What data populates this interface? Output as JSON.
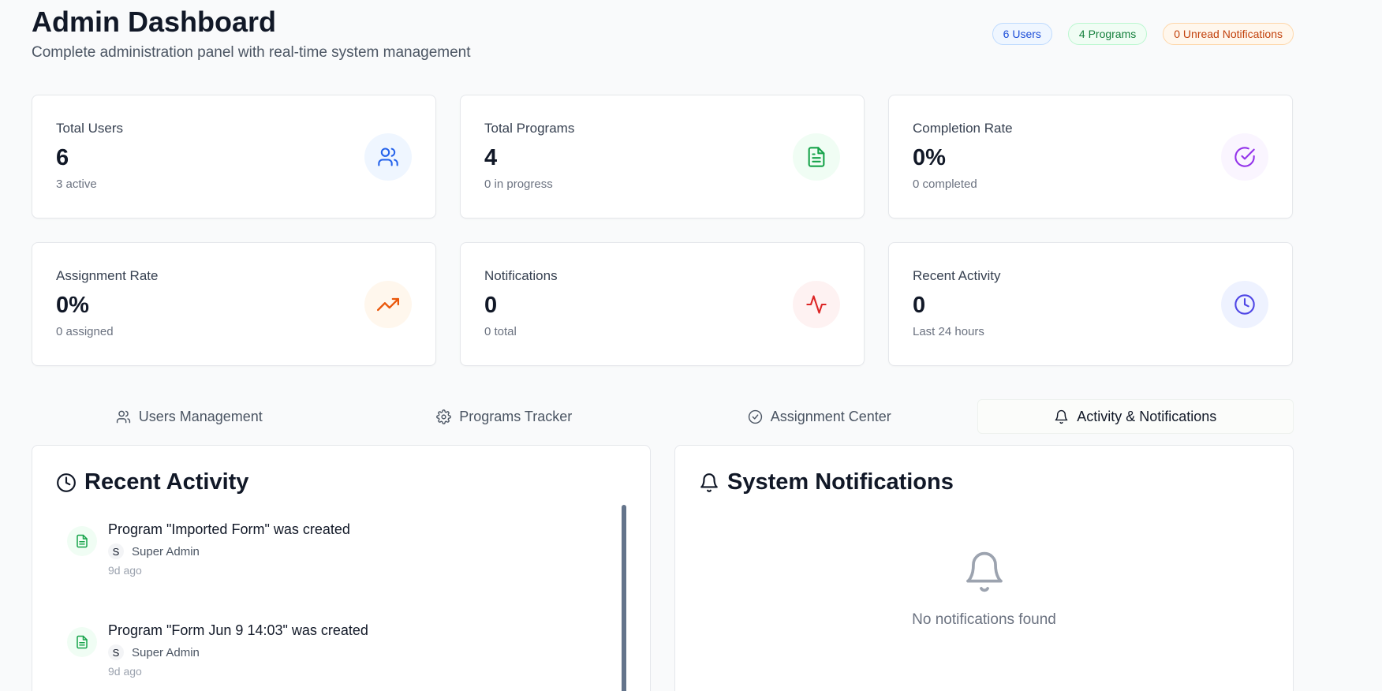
{
  "header": {
    "title": "Admin Dashboard",
    "subtitle": "Complete administration panel with real-time system management"
  },
  "badges": {
    "users": "6 Users",
    "programs": "4 Programs",
    "notifications": "0 Unread Notifications"
  },
  "stats": [
    {
      "label": "Total Users",
      "value": "6",
      "sub": "3 active",
      "icon": "users-icon",
      "color": "#2563eb",
      "bg": "#eff6ff"
    },
    {
      "label": "Total Programs",
      "value": "4",
      "sub": "0 in progress",
      "icon": "file-text-icon",
      "color": "#16a34a",
      "bg": "#f0fdf4"
    },
    {
      "label": "Completion Rate",
      "value": "0%",
      "sub": "0 completed",
      "icon": "check-circle-icon",
      "color": "#9333ea",
      "bg": "#faf5ff"
    },
    {
      "label": "Assignment Rate",
      "value": "0%",
      "sub": "0 assigned",
      "icon": "trending-up-icon",
      "color": "#ea580c",
      "bg": "#fff7ed"
    },
    {
      "label": "Notifications",
      "value": "0",
      "sub": "0 total",
      "icon": "activity-icon",
      "color": "#dc2626",
      "bg": "#fef2f2"
    },
    {
      "label": "Recent Activity",
      "value": "0",
      "sub": "Last 24 hours",
      "icon": "clock-icon",
      "color": "#4f46e5",
      "bg": "#eef2ff"
    }
  ],
  "tabs": [
    {
      "label": "Users Management",
      "icon": "users-icon",
      "active": false
    },
    {
      "label": "Programs Tracker",
      "icon": "gear-icon",
      "active": false
    },
    {
      "label": "Assignment Center",
      "icon": "check-circle-icon",
      "active": false
    },
    {
      "label": "Activity & Notifications",
      "icon": "bell-icon",
      "active": true
    }
  ],
  "recent_activity": {
    "title": "Recent Activity",
    "items": [
      {
        "title": "Program \"Imported Form\" was created",
        "avatar": "S",
        "user": "Super Admin",
        "time": "9d ago"
      },
      {
        "title": "Program \"Form Jun 9 14:03\" was created",
        "avatar": "S",
        "user": "Super Admin",
        "time": "9d ago"
      }
    ]
  },
  "notifications_panel": {
    "title": "System Notifications",
    "empty_text": "No notifications found"
  }
}
